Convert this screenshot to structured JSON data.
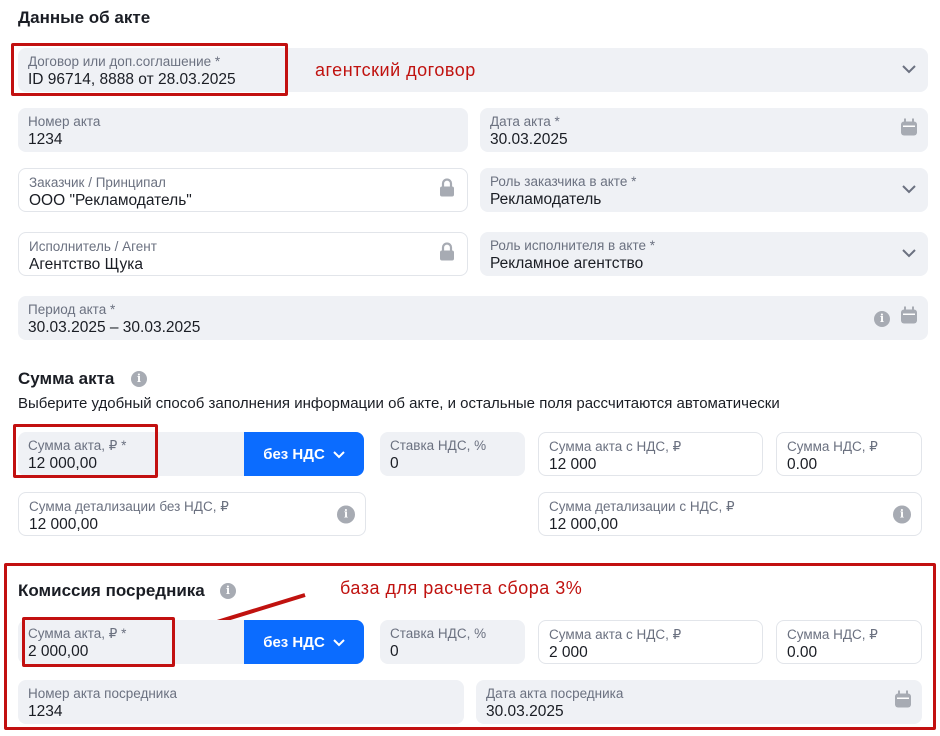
{
  "section1": {
    "title": "Данные об акте"
  },
  "contract": {
    "label": "Договор или доп.соглашение *",
    "value": "ID 96714, 8888 от 28.03.2025"
  },
  "annotation1": "агентский договор",
  "act_number": {
    "label": "Номер акта",
    "value": "1234"
  },
  "act_date": {
    "label": "Дата акта *",
    "value": "30.03.2025"
  },
  "customer": {
    "label": "Заказчик / Принципал",
    "value": "ООО \"Рекламодатель\""
  },
  "customer_role": {
    "label": "Роль заказчика в акте *",
    "value": "Рекламодатель"
  },
  "executor": {
    "label": "Исполнитель / Агент",
    "value": "Агентство Щука"
  },
  "executor_role": {
    "label": "Роль исполнителя в акте *",
    "value": "Рекламное агентство"
  },
  "period": {
    "label": "Период акта *",
    "value": "30.03.2025 – 30.03.2025"
  },
  "section2": {
    "title": "Сумма акта",
    "description": "Выберите удобный способ заполнения информации об акте, и остальные поля рассчитаются автоматически"
  },
  "sum": {
    "amount": {
      "label": "Сумма акта, ₽ *",
      "value": "12 000,00"
    },
    "vat_button": "без НДС",
    "vat_rate": {
      "label": "Ставка НДС, %",
      "value": "0"
    },
    "amount_vat": {
      "label": "Сумма акта с НДС, ₽",
      "value": "12 000"
    },
    "vat_sum": {
      "label": "Сумма НДС, ₽",
      "value": "0.00"
    },
    "detail_no_vat": {
      "label": "Сумма детализации без НДС, ₽",
      "value": "12 000,00"
    },
    "detail_vat": {
      "label": "Сумма детализации с НДС, ₽",
      "value": "12 000,00"
    }
  },
  "section3": {
    "title": "Комиссия посредника"
  },
  "annotation2": "база для расчета сбора 3%",
  "commission": {
    "amount": {
      "label": "Сумма акта, ₽ *",
      "value": "2 000,00"
    },
    "vat_button": "без НДС",
    "vat_rate": {
      "label": "Ставка НДС, %",
      "value": "0"
    },
    "amount_vat": {
      "label": "Сумма акта с НДС, ₽",
      "value": "2 000"
    },
    "vat_sum": {
      "label": "Сумма НДС, ₽",
      "value": "0.00"
    },
    "number": {
      "label": "Номер акта посредника",
      "value": "1234"
    },
    "date": {
      "label": "Дата акта посредника",
      "value": "30.03.2025"
    }
  },
  "colors": {
    "accent": "#0b6cff",
    "annotation": "#c0120f",
    "field_bg": "#eff1f5"
  }
}
